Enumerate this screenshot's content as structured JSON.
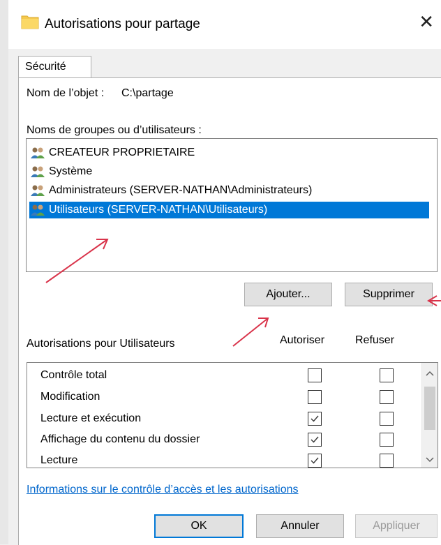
{
  "window": {
    "title": "Autorisations pour partage",
    "close_glyph": "✕"
  },
  "tabs": [
    {
      "label": "Sécurité"
    }
  ],
  "object": {
    "label": "Nom de l’objet :",
    "value": "C:\\partage"
  },
  "groups": {
    "label": "Noms de groupes ou d’utilisateurs :",
    "items": [
      {
        "label": "CREATEUR PROPRIETAIRE",
        "icon": "users-icon"
      },
      {
        "label": "Système",
        "icon": "users-icon"
      },
      {
        "label": "Administrateurs (SERVER-NATHAN\\Administrateurs)",
        "icon": "users-icon"
      },
      {
        "label": "Utilisateurs (SERVER-NATHAN\\Utilisateurs)",
        "icon": "users-icon",
        "selected": true
      }
    ],
    "add_label": "Ajouter...",
    "remove_label": "Supprimer"
  },
  "permissions": {
    "label": "Autorisations pour Utilisateurs",
    "allow_header": "Autoriser",
    "deny_header": "Refuser",
    "rows": [
      {
        "name": "Contrôle total",
        "allow": false,
        "deny": false
      },
      {
        "name": "Modification",
        "allow": false,
        "deny": false
      },
      {
        "name": "Lecture et exécution",
        "allow": true,
        "deny": false
      },
      {
        "name": "Affichage du contenu du dossier",
        "allow": true,
        "deny": false
      },
      {
        "name": "Lecture",
        "allow": true,
        "deny": false
      }
    ]
  },
  "link": {
    "text": "Informations sur le contrôle d’accès et les autorisations"
  },
  "footer": {
    "ok_label": "OK",
    "cancel_label": "Annuler",
    "apply_label": "Appliquer"
  },
  "colors": {
    "selection": "#0078d7",
    "annotation_arrow": "#d9334a",
    "link": "#0066cc"
  }
}
